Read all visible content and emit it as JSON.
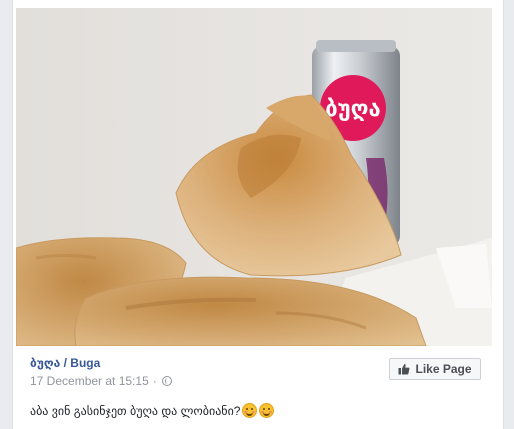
{
  "post": {
    "page_name": "ბუღა / Buga",
    "timestamp": "17 December at 15:15",
    "separator": "·",
    "privacy_icon": "globe-icon",
    "like_page_label": "Like Page",
    "like_icon": "thumbs-up-icon",
    "message": "აბა ვინ გასინჯეთ ბუღა და ლობიანი?",
    "emoji_icons": [
      "smiling-face-icon",
      "smiling-face-icon"
    ]
  },
  "photo": {
    "can_label": "ბუღა",
    "brand_color": "#e0195a"
  }
}
